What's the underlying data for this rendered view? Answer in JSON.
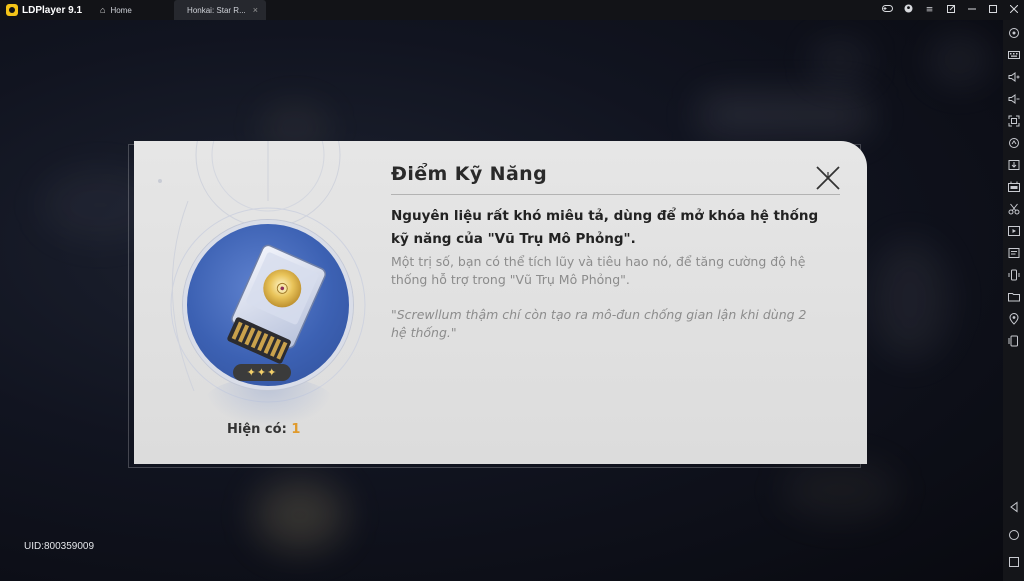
{
  "app": {
    "name": "LDPlayer 9.1"
  },
  "tabs": [
    {
      "label": "Home",
      "icon": "home-icon"
    },
    {
      "label": "Honkai: Star R...",
      "icon": "game-thumbnail",
      "close": "×"
    }
  ],
  "window_controls": [
    "gamepad-icon",
    "account-icon",
    "menu-icon",
    "popout-icon",
    "minimize-icon",
    "maximize-icon",
    "close-icon"
  ],
  "dialog": {
    "title": "Điểm Kỹ Năng",
    "description": "Nguyên liệu rất khó miêu tả, dùng để mở khóa hệ thống kỹ năng của \"Vũ Trụ Mô Phỏng\".",
    "detail": "Một trị số, bạn có thể tích lũy và tiêu hao nó, để tăng cường độ hệ thống hỗ trợ trong \"Vũ Trụ Mô Phỏng\".",
    "quote": "\"Screwllum thậm chí còn tạo ra mô-đun chống gian lận khi dùng 2 hệ thống.\"",
    "rarity_stars": "✦✦✦",
    "rarity": 3,
    "owned_label": "Hiện có:",
    "owned_count": "1",
    "item_icon": "memory-card-icon"
  },
  "uid": "UID:800359009",
  "sidebar": [
    "settings-icon",
    "keyboard-icon",
    "volume-up-icon",
    "volume-down-icon",
    "fullscreen-icon",
    "rotate-icon",
    "install-apk-icon",
    "fps-icon",
    "scissors-icon",
    "record-icon",
    "script-icon",
    "shake-icon",
    "folder-icon",
    "location-icon",
    "multi-instance-icon",
    "back-icon",
    "home-circle-icon",
    "recent-apps-icon"
  ],
  "colors": {
    "accent_orange": "#e09a2c",
    "dialog_bg": "#e2e2e2",
    "item_blue": "#3c61b3",
    "star_gold": "#f2cf6a"
  }
}
